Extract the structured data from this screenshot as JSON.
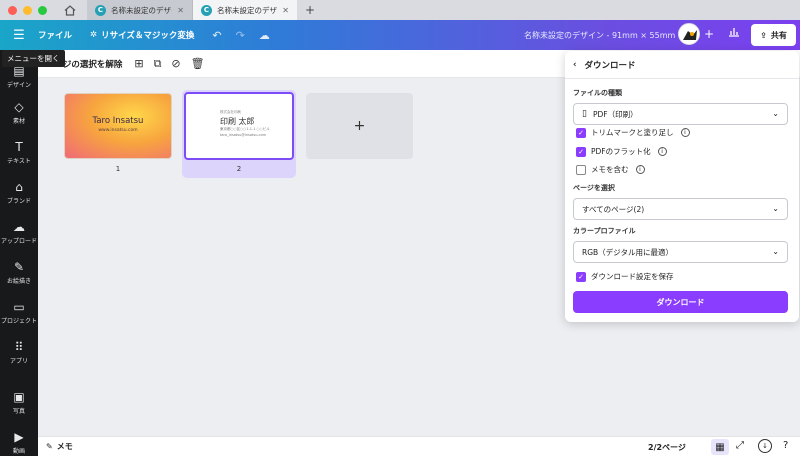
{
  "titlebar": {
    "tabs": [
      {
        "label": "名称未設定のデザイ…",
        "logo": "C"
      },
      {
        "label": "名称未設定のデザイ…",
        "logo": "C"
      }
    ],
    "traffic_colors": [
      "#fe5f57",
      "#febc2e",
      "#28c840"
    ]
  },
  "header": {
    "menu_file": "ファイル",
    "menu_resize": "リサイズ＆マジック変換",
    "doc_title": "名称未設定のデザイン - 91mm × 55mm",
    "share_label": "共有"
  },
  "tooltip": "メニューを開く",
  "sidebar": {
    "items": [
      {
        "label": "デザイン",
        "icon": "design-icon"
      },
      {
        "label": "素材",
        "icon": "elements-icon"
      },
      {
        "label": "テキスト",
        "icon": "text-icon"
      },
      {
        "label": "ブランド",
        "icon": "brand-icon"
      },
      {
        "label": "アップロード",
        "icon": "upload-icon"
      },
      {
        "label": "お絵描き",
        "icon": "draw-icon"
      },
      {
        "label": "プロジェクト",
        "icon": "folder-icon"
      },
      {
        "label": "アプリ",
        "icon": "apps-icon"
      },
      {
        "label": "写真",
        "icon": "photo-icon"
      },
      {
        "label": "動画",
        "icon": "video-icon"
      }
    ]
  },
  "toolbar": {
    "deselect_label": "ページの選択を解除"
  },
  "canvas": {
    "pages": [
      {
        "number": "1",
        "name": "Taro Insatsu",
        "url": "www.insatsu.com"
      },
      {
        "number": "2",
        "name": "印刷 太郎",
        "company": "株式会社印刷",
        "address": "東京都○○区○○1-1-1 ○○ビル",
        "email": "taro_insatsu@insatsu.com"
      }
    ],
    "add_page": "+"
  },
  "bottom": {
    "memo_label": "メモ",
    "page_count": "2/2ページ"
  },
  "download_panel": {
    "title": "ダウンロード",
    "file_type_label": "ファイルの種類",
    "file_type_value": "PDF（印刷）",
    "options": [
      {
        "label": "トリムマークと塗り足し",
        "checked": true,
        "info": true
      },
      {
        "label": "PDFのフラット化",
        "checked": true,
        "info": true
      },
      {
        "label": "メモを含む",
        "checked": false,
        "info": true
      }
    ],
    "page_select_label": "ページを選択",
    "page_select_value": "すべてのページ(2)",
    "color_profile_label": "カラープロファイル",
    "color_profile_value": "RGB（デジタル用に最適）",
    "save_settings_label": "ダウンロード設定を保存",
    "download_button": "ダウンロード",
    "accent_color": "#8b3dff"
  }
}
